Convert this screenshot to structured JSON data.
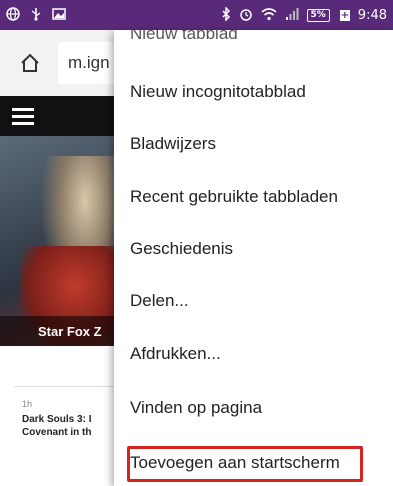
{
  "status_bar": {
    "time": "9:48",
    "battery": "5%",
    "battery_plus": "+",
    "icons": [
      "globe-icon",
      "usb-icon",
      "image-icon",
      "bluetooth-icon",
      "alarm-icon",
      "wifi-icon",
      "signal-icon"
    ]
  },
  "browser": {
    "url": "m.ign"
  },
  "page": {
    "hero_caption": "Star Fox Z",
    "article_time": "1h",
    "article_title": "Dark Souls 3: I Covenant in th"
  },
  "menu": {
    "items": [
      {
        "label": "Nieuw tabblad"
      },
      {
        "label": "Nieuw incognitotabblad"
      },
      {
        "label": "Bladwijzers"
      },
      {
        "label": "Recent gebruikte tabbladen"
      },
      {
        "label": "Geschiedenis"
      },
      {
        "label": "Delen..."
      },
      {
        "label": "Afdrukken..."
      },
      {
        "label": "Vinden op pagina"
      },
      {
        "label": "Toevoegen aan startscherm"
      }
    ],
    "highlighted_index": 8
  },
  "colors": {
    "status_bar": "#5a2a7a",
    "highlight": "#d9231f"
  }
}
